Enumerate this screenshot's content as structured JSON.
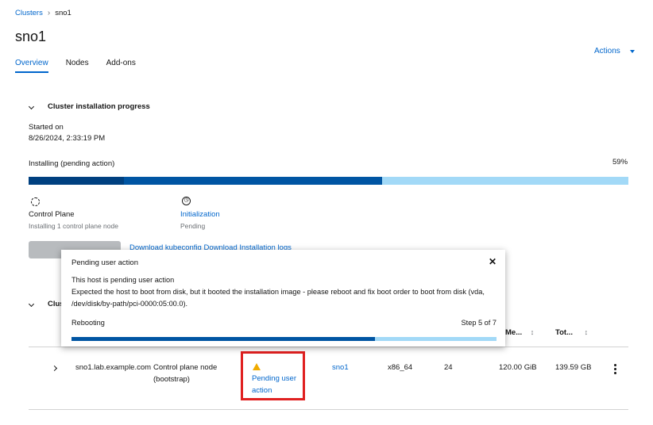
{
  "breadcrumb": {
    "parent": "Clusters",
    "current": "sno1"
  },
  "page_title": "sno1",
  "tabs": [
    {
      "label": "Overview",
      "active": true
    },
    {
      "label": "Nodes",
      "active": false
    },
    {
      "label": "Add-ons",
      "active": false
    }
  ],
  "actions_label": "Actions",
  "progress_section": {
    "heading": "Cluster installation progress",
    "started_label": "Started on",
    "started_value": "8/26/2024, 2:33:19 PM",
    "status_label": "Installing (pending action)",
    "percent_label": "59%",
    "percent": 59,
    "steps": [
      {
        "title": "Control Plane",
        "subtitle": "Installing 1 control plane node"
      },
      {
        "title": "Initialization",
        "subtitle": "Pending"
      }
    ],
    "partial_links": "Download kubeconfig   Download Installation logs"
  },
  "popover": {
    "title": "Pending user action",
    "line1": "This host is pending user action",
    "line2": "Expected the host to boot from disk, but it booted the installation image - please reboot and fix boot order to boot from disk (vda, /dev/disk/by-path/pci-0000:05:00.0).",
    "status": "Rebooting",
    "step": "Step 5 of 7",
    "step_fraction": 0.714
  },
  "hosts_section": {
    "heading_partial": "Clus",
    "columns": {
      "memory": "Me...",
      "total": "Tot..."
    },
    "rows": [
      {
        "hostname": "sno1.lab.example.com",
        "role": "Control plane node (bootstrap)",
        "status": "Pending user action",
        "cluster": "sno1",
        "arch": "x86_64",
        "cores": "24",
        "memory": "120.00 GiB",
        "disk": "139.59 GB"
      }
    ]
  },
  "colors": {
    "link": "#0066cc",
    "progress": "#0055a3",
    "progress_bg": "#a2d9f7",
    "warning": "#f0ab00",
    "highlight": "#e02020"
  }
}
